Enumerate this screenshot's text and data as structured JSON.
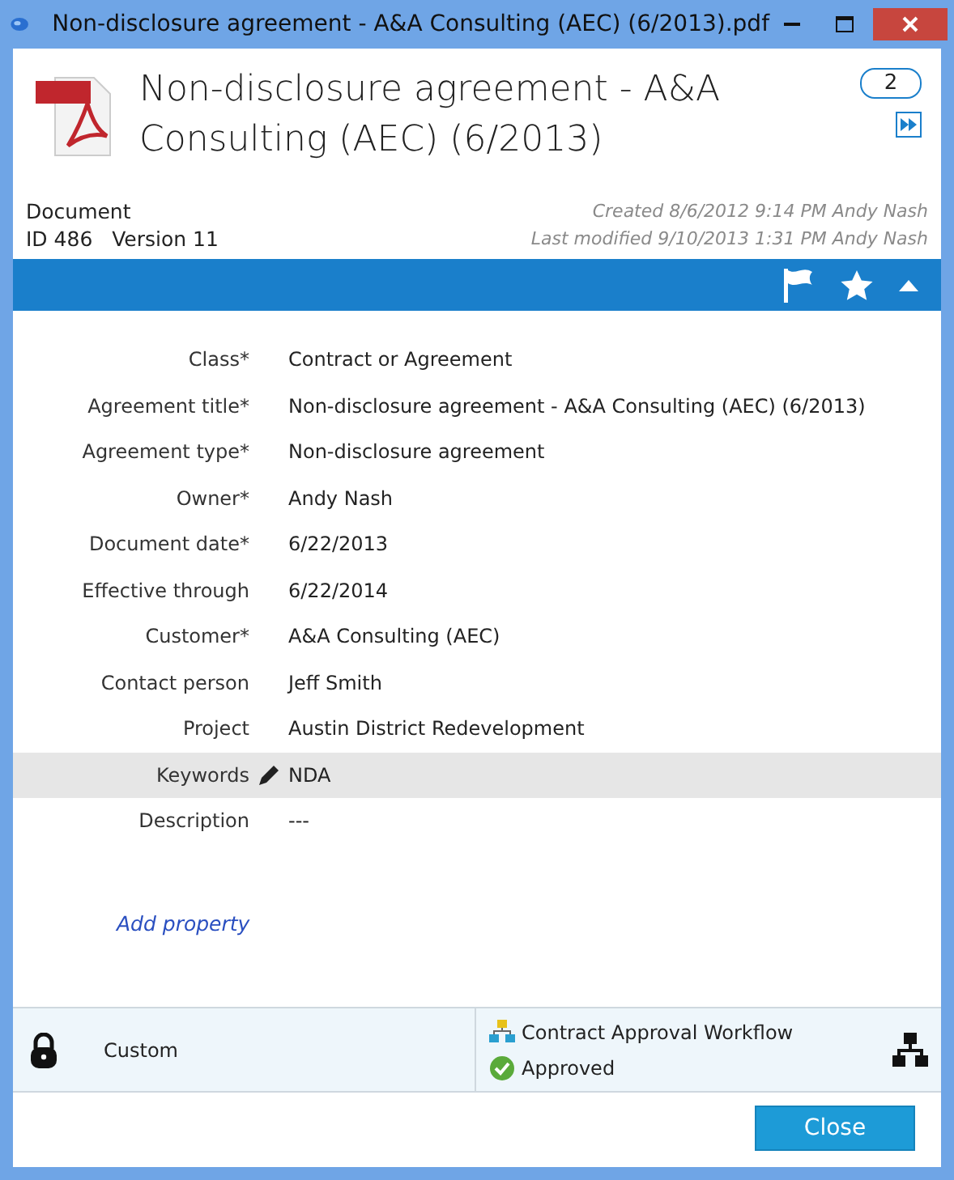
{
  "window": {
    "title": "Non-disclosure agreement - A&A Consulting (AEC) (6/2013).pdf"
  },
  "header": {
    "title": "Non-disclosure agreement - A&A Consulting (AEC) (6/2013)",
    "comment_count": "2",
    "type": "Document",
    "id": "ID 486",
    "version": "Version 11",
    "created": "Created 8/6/2012 9:14 PM Andy Nash",
    "modified": "Last modified 9/10/2013 1:31 PM Andy Nash"
  },
  "properties": [
    {
      "label": "Class*",
      "value": "Contract or Agreement",
      "highlighted": false
    },
    {
      "label": "Agreement title*",
      "value": "Non-disclosure agreement - A&A Consulting (AEC) (6/2013)",
      "highlighted": false
    },
    {
      "label": "Agreement type*",
      "value": "Non-disclosure agreement",
      "highlighted": false
    },
    {
      "label": "Owner*",
      "value": "Andy Nash",
      "highlighted": false
    },
    {
      "label": "Document date*",
      "value": "6/22/2013",
      "highlighted": false
    },
    {
      "label": "Effective through",
      "value": "6/22/2014",
      "highlighted": false
    },
    {
      "label": "Customer*",
      "value": "A&A Consulting (AEC)",
      "highlighted": false
    },
    {
      "label": "Contact person",
      "value": "Jeff Smith",
      "highlighted": false
    },
    {
      "label": "Project",
      "value": "Austin District Redevelopment",
      "highlighted": false
    },
    {
      "label": "Keywords",
      "value": "NDA",
      "highlighted": true
    },
    {
      "label": "Description",
      "value": "---",
      "highlighted": false
    }
  ],
  "add_property": "Add property",
  "footer": {
    "permissions": "Custom",
    "workflow": "Contract Approval Workflow",
    "state": "Approved"
  },
  "buttons": [
    "Close"
  ]
}
